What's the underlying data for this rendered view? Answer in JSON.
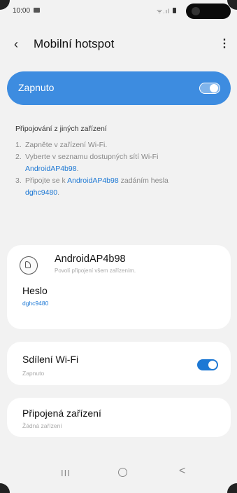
{
  "status_bar": {
    "time": "10:00",
    "signal_text": "ᯤ.ıl"
  },
  "app_bar": {
    "title": "Mobilní hotspot",
    "back_icon": "‹",
    "more_icon": "⋮"
  },
  "master_toggle": {
    "label": "Zapnuto",
    "state": "on",
    "color": "#3d8ce0"
  },
  "instructions": {
    "heading": "Připojování z jiných zařízení",
    "steps": [
      {
        "num": "1.",
        "text": "Zapněte v zařízení Wi-Fi."
      },
      {
        "num": "2.",
        "text_before": "Vyberte v seznamu dostupných sítí Wi-Fi",
        "link": "AndroidAP4b98",
        "text_after": "."
      },
      {
        "num": "3.",
        "text_before": "Připojte se k",
        "link": "AndroidAP4b98",
        "text_middle": "zadáním hesla",
        "link2": "dghc9480",
        "text_after": "."
      }
    ]
  },
  "network": {
    "name": "AndroidAP4b98",
    "subtitle": "Povolí připojení všem zařízením.",
    "password_label": "Heslo",
    "password_value": "dghc9480"
  },
  "wifi_sharing": {
    "label": "Sdílení Wi-Fi",
    "status": "Zapnuto",
    "state": "on"
  },
  "connected_devices": {
    "label": "Připojená zařízení",
    "status": "Žádná zařízení"
  },
  "nav_bar": {
    "recent": "III",
    "back": "<"
  },
  "colors": {
    "accent": "#1d78d4",
    "toggle_bg": "#3d8ce0",
    "background": "#f2f2f2"
  }
}
